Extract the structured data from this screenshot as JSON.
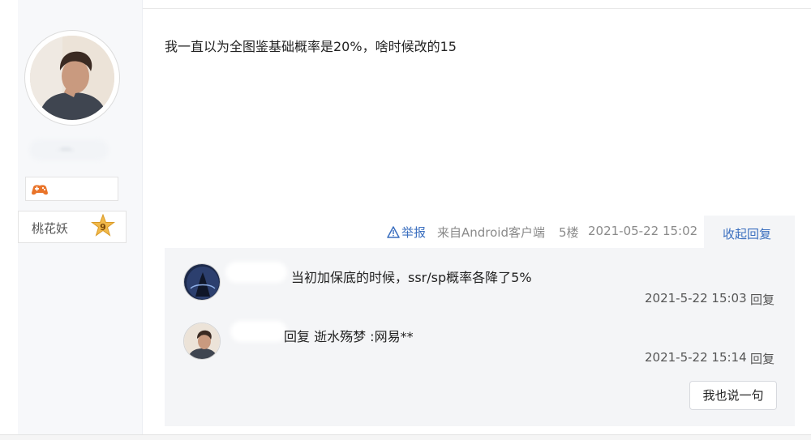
{
  "post": {
    "text": "我一直以为全图鉴基础概率是20%，啥时候改的15",
    "report_label": "举报",
    "source": "来自Android客户端",
    "floor": "5楼",
    "time": "2021-05-22 15:02",
    "collapse_label": "收起回复"
  },
  "author": {
    "name_blurred": "· ***··",
    "level_title": "桃花妖",
    "level": "9"
  },
  "replies": [
    {
      "text": "当初加保底的时候，ssr/sp概率各降了5%",
      "time": "2021-5-22 15:03",
      "reply_label": "回复"
    },
    {
      "text": "回复 逝水殇梦 :网易**",
      "time": "2021-5-22 15:14",
      "reply_label": "回复"
    }
  ],
  "say_button_label": "我也说一句",
  "colors": {
    "link": "#3b6fbf",
    "panel_bg": "#f4f5f7",
    "star": "#f1b94a"
  },
  "icons": [
    "warning-icon",
    "game-controller-icon",
    "level-star-icon"
  ]
}
